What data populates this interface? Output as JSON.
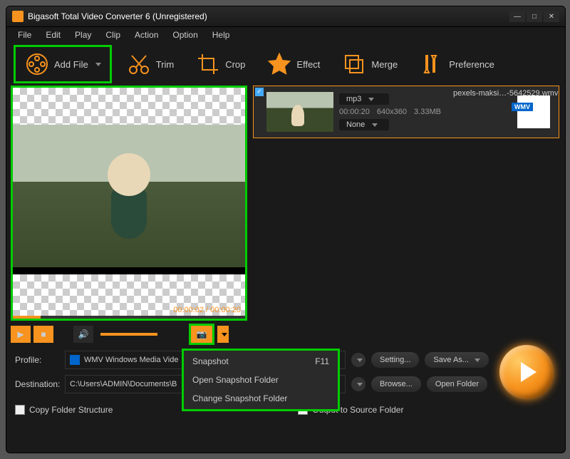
{
  "window": {
    "title": "Bigasoft Total Video Converter 6 (Unregistered)"
  },
  "menus": [
    "File",
    "Edit",
    "Play",
    "Clip",
    "Action",
    "Option",
    "Help"
  ],
  "toolbar": {
    "add_file": "Add File",
    "trim": "Trim",
    "crop": "Crop",
    "effect": "Effect",
    "merge": "Merge",
    "preference": "Preference"
  },
  "preview": {
    "timecode": "00:00:02 / 00:00:20"
  },
  "file": {
    "name": "pexels-maksi…-5642529.wmv",
    "format_sel": "mp3",
    "subtitle_sel": "None",
    "duration": "00:00:20",
    "resolution": "640x360",
    "size": "3.33MB",
    "badge": "WMV"
  },
  "snapshot_menu": {
    "item1": "Snapshot",
    "item1_key": "F11",
    "item2": "Open Snapshot Folder",
    "item3": "Change Snapshot Folder"
  },
  "bottom": {
    "profile_label": "Profile:",
    "profile_value": "WMV Windows Media Vide",
    "destination_label": "Destination:",
    "destination_value": "C:\\Users\\ADMIN\\Documents\\B",
    "setting": "Setting...",
    "save_as": "Save As...",
    "browse": "Browse...",
    "open_folder": "Open Folder",
    "copy_folder": "Copy Folder Structure",
    "output_source": "Output to Source Folder"
  }
}
